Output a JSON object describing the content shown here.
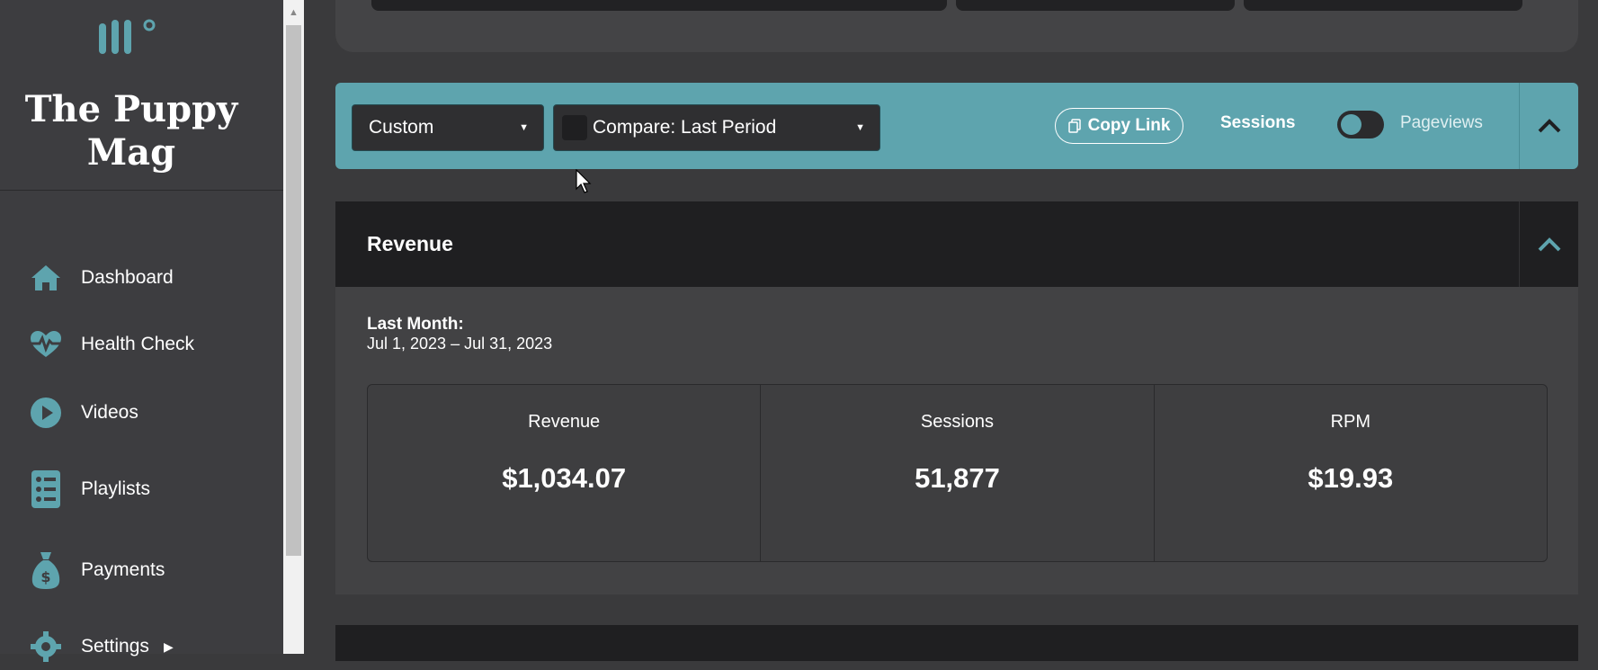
{
  "brand": {
    "name": "The Puppy Mag",
    "logo_icon": "mv-logo"
  },
  "sidebar": {
    "items": [
      {
        "label": "Dashboard",
        "icon": "home-icon"
      },
      {
        "label": "Health Check",
        "icon": "heartbeat-icon"
      },
      {
        "label": "Videos",
        "icon": "play-circle-icon"
      },
      {
        "label": "Playlists",
        "icon": "list-icon"
      },
      {
        "label": "Payments",
        "icon": "money-bag-icon"
      },
      {
        "label": "Settings",
        "icon": "gear-icon"
      }
    ]
  },
  "toolbar": {
    "date_range": "Custom",
    "compare": "Compare: Last Period",
    "copy_link": "Copy Link",
    "toggle_left": "Sessions",
    "toggle_right": "Pageviews",
    "toggle_state": "Sessions"
  },
  "revenue": {
    "title": "Revenue",
    "period_label": "Last Month:",
    "period_range": "Jul 1, 2023 – Jul 31, 2023",
    "stats": [
      {
        "label": "Revenue",
        "value": "$1,034.07"
      },
      {
        "label": "Sessions",
        "value": "51,877"
      },
      {
        "label": "RPM",
        "value": "$19.93"
      }
    ]
  },
  "colors": {
    "accent": "#5ea4ae",
    "sidebar": "#3d3d40",
    "panel_header": "#1f1f21"
  }
}
